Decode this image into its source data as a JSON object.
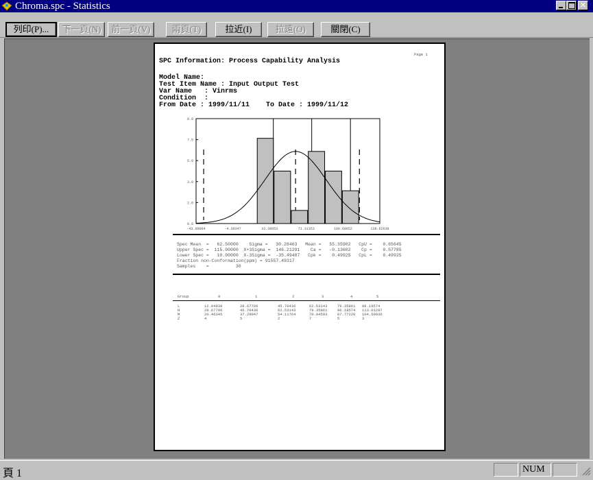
{
  "window": {
    "title": "Chroma.spc - Statistics"
  },
  "toolbar": {
    "print": "列印(P)...",
    "next_page": "下一頁(N)",
    "prev_page": "前一頁(V)",
    "two_pages": "兩頁(T)",
    "zoom_in": "拉近(I)",
    "zoom_out": "拉遠(O)",
    "close": "關閉(C)"
  },
  "report": {
    "page_label": "Page 1",
    "title": "SPC Information: Process Capability Analysis",
    "lines": [
      "Model Name:",
      "Test Item Name : Input Output Test",
      "Var Name   : Vinrms",
      "Condition  :",
      "From Date : 1999/11/11    To Date : 1999/11/12"
    ],
    "stats_lines": [
      "Spec Mean  =   62.50000    Sigma =   30.28463   Mean =   55.35902   CpU =    0.65645",
      "Upper Spec =  115.00000  X+3Sigma =  146.21291    Ca =   -0.13602    Cp =    0.57785",
      "Lower Spec =   10.00000  X-3Sigma =  -35.49487   Cpk =    0.49925   CpL =    0.49925",
      "Fraction non-Conformation(ppm) = 91557.49317",
      "Samples    =          30"
    ],
    "group_header": [
      "Group",
      "0",
      "1",
      "2",
      "3",
      "4",
      "5"
    ],
    "group_rows": [
      {
        "label": "L",
        "values": [
          "12.04938",
          "28.67706",
          "45.70436",
          "62.53143",
          "79.35861",
          "96.18574"
        ]
      },
      {
        "label": "H",
        "values": [
          "28.67706",
          "45.70436",
          "62.53143",
          "79.35861",
          "96.18574",
          "113.01297"
        ]
      },
      {
        "label": "M",
        "values": [
          "20.46345",
          "37.29047",
          "54.11764",
          "70.94503",
          "87.77220",
          "104.59936"
        ]
      },
      {
        "label": "Z",
        "values": [
          "4",
          "5",
          "2",
          "7",
          "5",
          "3"
        ]
      }
    ]
  },
  "chart_data": {
    "type": "bar",
    "title": "",
    "x_tick_labels": [
      "-43.00064",
      "-4.39347",
      "33.38653",
      "71.31353",
      "109.60852",
      "138.62638"
    ],
    "y_tick_labels": [
      "8.0",
      "7.5",
      "5.0",
      "3.0",
      "2.0",
      "0.0"
    ],
    "bars": [
      {
        "value": 6.5
      },
      {
        "value": 4.0
      },
      {
        "value": 1.0
      },
      {
        "value": 5.5
      },
      {
        "value": 4.0
      },
      {
        "value": 2.5
      }
    ],
    "ylim": [
      0,
      8
    ],
    "normal_curve": {
      "mean": 55.35902,
      "sigma": 30.28463
    }
  },
  "status": {
    "page": "頁 1",
    "num": "NUM"
  }
}
